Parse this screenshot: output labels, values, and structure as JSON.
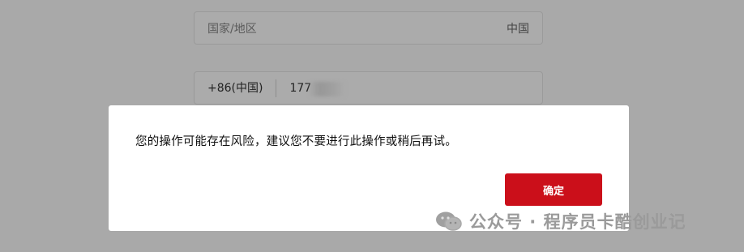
{
  "form": {
    "region_label": "国家/地区",
    "region_value": "中国",
    "phone_code": "+86(中国)",
    "phone_number_visible": "177"
  },
  "dialog": {
    "message": "您的操作可能存在风险，建议您不要进行此操作或稍后再试。",
    "confirm_label": "确定"
  },
  "watermark": {
    "text": "公众号 · 程序员卡酷创业记"
  },
  "colors": {
    "overlay": "#a9a9a9",
    "dialog_bg": "#ffffff",
    "confirm_bg": "#cb0f1a",
    "confirm_text": "#ffffff"
  }
}
